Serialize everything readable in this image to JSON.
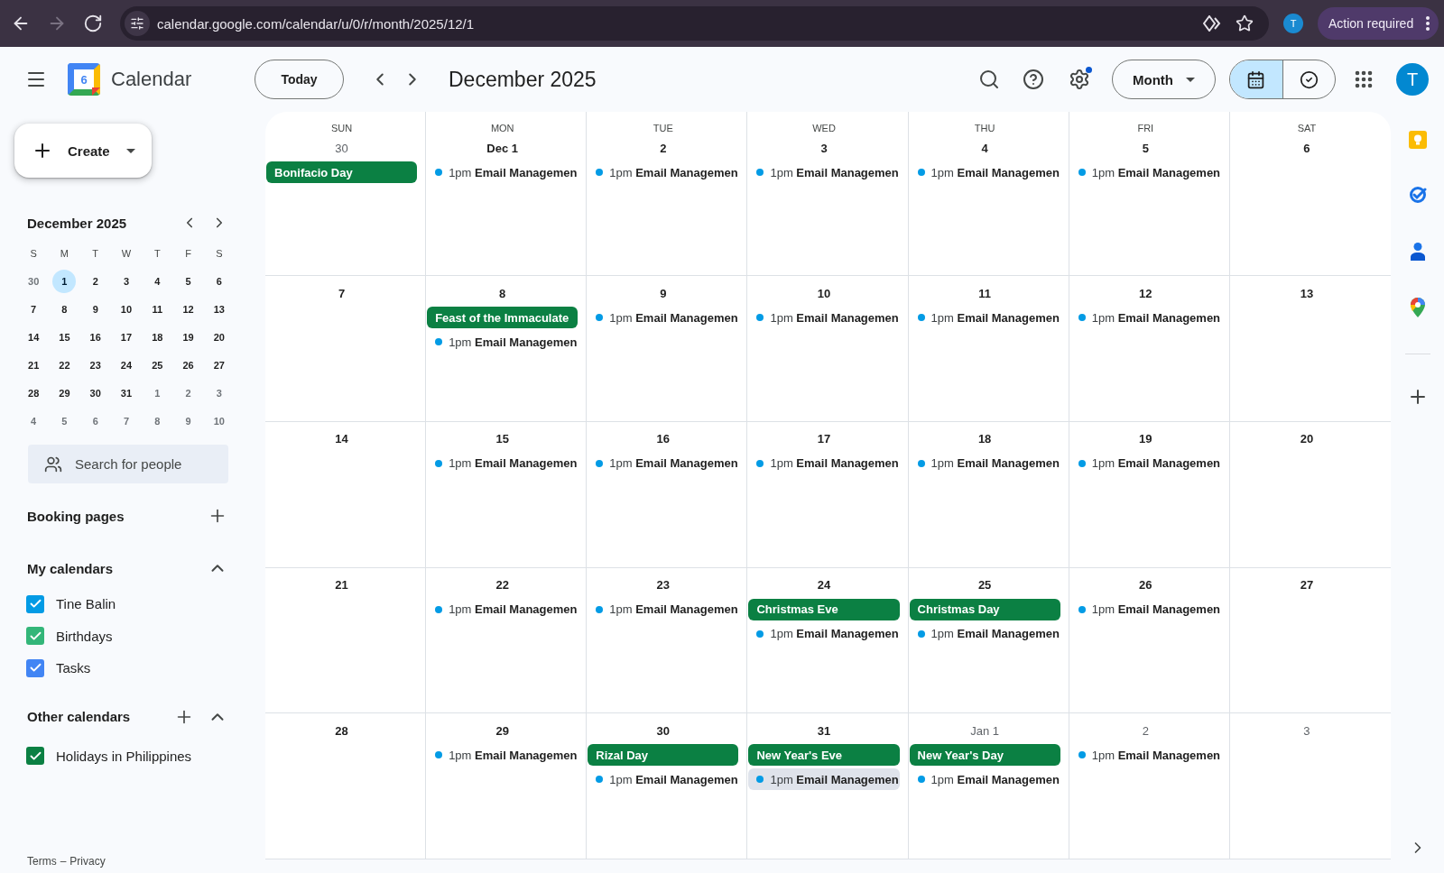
{
  "browser": {
    "nav": [
      {
        "kind": "back",
        "disabled": false
      },
      {
        "kind": "forward",
        "disabled": true
      },
      {
        "kind": "reload",
        "disabled": false
      }
    ],
    "url": "calendar.google.com/calendar/u/0/r/month/2025/12/1",
    "profile_initial": "T",
    "action_button": "Action required"
  },
  "header": {
    "logo_day": "6",
    "app_name": "Calendar",
    "today_button": "Today",
    "title": "December 2025",
    "settings_badge": true,
    "view_dropdown": "Month",
    "view_toggle": [
      {
        "kind": "calendar",
        "selected": true
      },
      {
        "kind": "tasks",
        "selected": false
      }
    ],
    "avatar_initial": "T"
  },
  "sidebar": {
    "create_button": "Create",
    "mini_calendar": {
      "title": "December 2025",
      "weekdays": [
        "S",
        "M",
        "T",
        "W",
        "T",
        "F",
        "S"
      ],
      "weeks": [
        [
          {
            "day": "30",
            "in_month": false,
            "selected": false
          },
          {
            "day": "1",
            "in_month": true,
            "selected": true
          },
          {
            "day": "2",
            "in_month": true,
            "selected": false
          },
          {
            "day": "3",
            "in_month": true,
            "selected": false
          },
          {
            "day": "4",
            "in_month": true,
            "selected": false
          },
          {
            "day": "5",
            "in_month": true,
            "selected": false
          },
          {
            "day": "6",
            "in_month": true,
            "selected": false
          }
        ],
        [
          {
            "day": "7",
            "in_month": true,
            "selected": false
          },
          {
            "day": "8",
            "in_month": true,
            "selected": false
          },
          {
            "day": "9",
            "in_month": true,
            "selected": false
          },
          {
            "day": "10",
            "in_month": true,
            "selected": false
          },
          {
            "day": "11",
            "in_month": true,
            "selected": false
          },
          {
            "day": "12",
            "in_month": true,
            "selected": false
          },
          {
            "day": "13",
            "in_month": true,
            "selected": false
          }
        ],
        [
          {
            "day": "14",
            "in_month": true,
            "selected": false
          },
          {
            "day": "15",
            "in_month": true,
            "selected": false
          },
          {
            "day": "16",
            "in_month": true,
            "selected": false
          },
          {
            "day": "17",
            "in_month": true,
            "selected": false
          },
          {
            "day": "18",
            "in_month": true,
            "selected": false
          },
          {
            "day": "19",
            "in_month": true,
            "selected": false
          },
          {
            "day": "20",
            "in_month": true,
            "selected": false
          }
        ],
        [
          {
            "day": "21",
            "in_month": true,
            "selected": false
          },
          {
            "day": "22",
            "in_month": true,
            "selected": false
          },
          {
            "day": "23",
            "in_month": true,
            "selected": false
          },
          {
            "day": "24",
            "in_month": true,
            "selected": false
          },
          {
            "day": "25",
            "in_month": true,
            "selected": false
          },
          {
            "day": "26",
            "in_month": true,
            "selected": false
          },
          {
            "day": "27",
            "in_month": true,
            "selected": false
          }
        ],
        [
          {
            "day": "28",
            "in_month": true,
            "selected": false
          },
          {
            "day": "29",
            "in_month": true,
            "selected": false
          },
          {
            "day": "30",
            "in_month": true,
            "selected": false
          },
          {
            "day": "31",
            "in_month": true,
            "selected": false
          },
          {
            "day": "1",
            "in_month": false,
            "selected": false
          },
          {
            "day": "2",
            "in_month": false,
            "selected": false
          },
          {
            "day": "3",
            "in_month": false,
            "selected": false
          }
        ],
        [
          {
            "day": "4",
            "in_month": false,
            "selected": false
          },
          {
            "day": "5",
            "in_month": false,
            "selected": false
          },
          {
            "day": "6",
            "in_month": false,
            "selected": false
          },
          {
            "day": "7",
            "in_month": false,
            "selected": false
          },
          {
            "day": "8",
            "in_month": false,
            "selected": false
          },
          {
            "day": "9",
            "in_month": false,
            "selected": false
          },
          {
            "day": "10",
            "in_month": false,
            "selected": false
          }
        ]
      ]
    },
    "people_search": {
      "placeholder": "Search for people"
    },
    "booking_pages": {
      "title": "Booking pages"
    },
    "my_calendars": {
      "title": "My calendars",
      "expanded": true,
      "items": [
        {
          "name": "Tine Balin",
          "checked": true,
          "color": "#039be5"
        },
        {
          "name": "Birthdays",
          "checked": true,
          "color": "#33b679"
        },
        {
          "name": "Tasks",
          "checked": true,
          "color": "#4285f4"
        }
      ]
    },
    "other_calendars": {
      "title": "Other calendars",
      "expanded": true,
      "items": [
        {
          "name": "Holidays in Philippines",
          "checked": true,
          "color": "#0b8043"
        }
      ]
    },
    "footer": {
      "links": [
        "Terms",
        "Privacy"
      ],
      "separator": "–"
    }
  },
  "grid": {
    "weekdays": [
      "SUN",
      "MON",
      "TUE",
      "WED",
      "THU",
      "FRI",
      "SAT"
    ],
    "weeks": [
      {
        "days": [
          {
            "date": "30",
            "in_month": false,
            "events": [
              {
                "kind": "holiday",
                "title": "Bonifacio Day",
                "color": "#0b8043",
                "selected": false
              }
            ]
          },
          {
            "date": "Dec 1",
            "in_month": true,
            "events": [
              {
                "kind": "timed",
                "time": "1pm",
                "title": "Email Managemen",
                "color": "#039be5",
                "selected": false
              }
            ]
          },
          {
            "date": "2",
            "in_month": true,
            "events": [
              {
                "kind": "timed",
                "time": "1pm",
                "title": "Email Managemen",
                "color": "#039be5",
                "selected": false
              }
            ]
          },
          {
            "date": "3",
            "in_month": true,
            "events": [
              {
                "kind": "timed",
                "time": "1pm",
                "title": "Email Managemen",
                "color": "#039be5",
                "selected": false
              }
            ]
          },
          {
            "date": "4",
            "in_month": true,
            "events": [
              {
                "kind": "timed",
                "time": "1pm",
                "title": "Email Managemen",
                "color": "#039be5",
                "selected": false
              }
            ]
          },
          {
            "date": "5",
            "in_month": true,
            "events": [
              {
                "kind": "timed",
                "time": "1pm",
                "title": "Email Managemen",
                "color": "#039be5",
                "selected": false
              }
            ]
          },
          {
            "date": "6",
            "in_month": true
          }
        ]
      },
      {
        "days": [
          {
            "date": "7",
            "in_month": true
          },
          {
            "date": "8",
            "in_month": true,
            "events": [
              {
                "kind": "holiday",
                "title": "Feast of the Immaculate",
                "color": "#0b8043",
                "selected": false
              },
              {
                "kind": "timed",
                "time": "1pm",
                "title": "Email Managemen",
                "color": "#039be5",
                "selected": false
              }
            ]
          },
          {
            "date": "9",
            "in_month": true,
            "events": [
              {
                "kind": "timed",
                "time": "1pm",
                "title": "Email Managemen",
                "color": "#039be5",
                "selected": false
              }
            ]
          },
          {
            "date": "10",
            "in_month": true,
            "events": [
              {
                "kind": "timed",
                "time": "1pm",
                "title": "Email Managemen",
                "color": "#039be5",
                "selected": false
              }
            ]
          },
          {
            "date": "11",
            "in_month": true,
            "events": [
              {
                "kind": "timed",
                "time": "1pm",
                "title": "Email Managemen",
                "color": "#039be5",
                "selected": false
              }
            ]
          },
          {
            "date": "12",
            "in_month": true,
            "events": [
              {
                "kind": "timed",
                "time": "1pm",
                "title": "Email Managemen",
                "color": "#039be5",
                "selected": false
              }
            ]
          },
          {
            "date": "13",
            "in_month": true
          }
        ]
      },
      {
        "days": [
          {
            "date": "14",
            "in_month": true
          },
          {
            "date": "15",
            "in_month": true,
            "events": [
              {
                "kind": "timed",
                "time": "1pm",
                "title": "Email Managemen",
                "color": "#039be5",
                "selected": false
              }
            ]
          },
          {
            "date": "16",
            "in_month": true,
            "events": [
              {
                "kind": "timed",
                "time": "1pm",
                "title": "Email Managemen",
                "color": "#039be5",
                "selected": false
              }
            ]
          },
          {
            "date": "17",
            "in_month": true,
            "events": [
              {
                "kind": "timed",
                "time": "1pm",
                "title": "Email Managemen",
                "color": "#039be5",
                "selected": false
              }
            ]
          },
          {
            "date": "18",
            "in_month": true,
            "events": [
              {
                "kind": "timed",
                "time": "1pm",
                "title": "Email Managemen",
                "color": "#039be5",
                "selected": false
              }
            ]
          },
          {
            "date": "19",
            "in_month": true,
            "events": [
              {
                "kind": "timed",
                "time": "1pm",
                "title": "Email Managemen",
                "color": "#039be5",
                "selected": false
              }
            ]
          },
          {
            "date": "20",
            "in_month": true
          }
        ]
      },
      {
        "days": [
          {
            "date": "21",
            "in_month": true
          },
          {
            "date": "22",
            "in_month": true,
            "events": [
              {
                "kind": "timed",
                "time": "1pm",
                "title": "Email Managemen",
                "color": "#039be5",
                "selected": false
              }
            ]
          },
          {
            "date": "23",
            "in_month": true,
            "events": [
              {
                "kind": "timed",
                "time": "1pm",
                "title": "Email Managemen",
                "color": "#039be5",
                "selected": false
              }
            ]
          },
          {
            "date": "24",
            "in_month": true,
            "events": [
              {
                "kind": "holiday",
                "title": "Christmas Eve",
                "color": "#0b8043",
                "selected": false
              },
              {
                "kind": "timed",
                "time": "1pm",
                "title": "Email Managemen",
                "color": "#039be5",
                "selected": false
              }
            ]
          },
          {
            "date": "25",
            "in_month": true,
            "events": [
              {
                "kind": "holiday",
                "title": "Christmas Day",
                "color": "#0b8043",
                "selected": false
              },
              {
                "kind": "timed",
                "time": "1pm",
                "title": "Email Managemen",
                "color": "#039be5",
                "selected": false
              }
            ]
          },
          {
            "date": "26",
            "in_month": true,
            "events": [
              {
                "kind": "timed",
                "time": "1pm",
                "title": "Email Managemen",
                "color": "#039be5",
                "selected": false
              }
            ]
          },
          {
            "date": "27",
            "in_month": true
          }
        ]
      },
      {
        "days": [
          {
            "date": "28",
            "in_month": true
          },
          {
            "date": "29",
            "in_month": true,
            "events": [
              {
                "kind": "timed",
                "time": "1pm",
                "title": "Email Managemen",
                "color": "#039be5",
                "selected": false
              }
            ]
          },
          {
            "date": "30",
            "in_month": true,
            "events": [
              {
                "kind": "holiday",
                "title": "Rizal Day",
                "color": "#0b8043",
                "selected": false
              },
              {
                "kind": "timed",
                "time": "1pm",
                "title": "Email Managemen",
                "color": "#039be5",
                "selected": false
              }
            ]
          },
          {
            "date": "31",
            "in_month": true,
            "events": [
              {
                "kind": "holiday",
                "title": "New Year's Eve",
                "color": "#0b8043",
                "selected": false
              },
              {
                "kind": "timed",
                "time": "1pm",
                "title": "Email Managemen",
                "color": "#039be5",
                "selected": true
              }
            ]
          },
          {
            "date": "Jan 1",
            "in_month": false,
            "events": [
              {
                "kind": "holiday",
                "title": "New Year's Day",
                "color": "#0b8043",
                "selected": false
              },
              {
                "kind": "timed",
                "time": "1pm",
                "title": "Email Managemen",
                "color": "#039be5",
                "selected": false
              }
            ]
          },
          {
            "date": "2",
            "in_month": false,
            "events": [
              {
                "kind": "timed",
                "time": "1pm",
                "title": "Email Managemen",
                "color": "#039be5",
                "selected": false
              }
            ]
          },
          {
            "date": "3",
            "in_month": false
          }
        ]
      }
    ]
  }
}
